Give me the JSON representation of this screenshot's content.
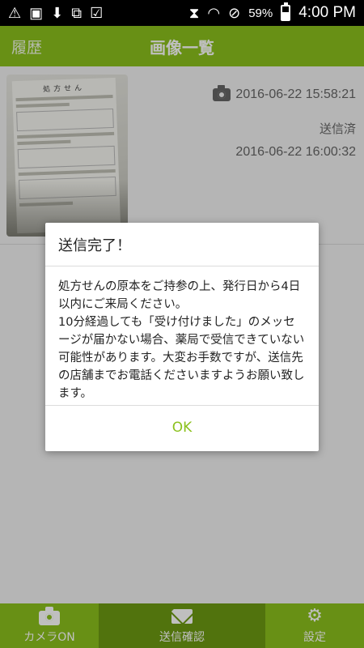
{
  "status_bar": {
    "left_icons": [
      "warning-icon",
      "image-icon",
      "download-icon",
      "screen-share-icon",
      "clipboard-check-icon"
    ],
    "right_icons": [
      "vibrate-mute-icon",
      "wifi-icon",
      "do-not-disturb-icon",
      "battery-icon"
    ],
    "battery": "59%",
    "battery_level": 0.59,
    "time": "4:00 PM"
  },
  "header": {
    "back_label": "履歴",
    "title": "画像一覧"
  },
  "list": {
    "items": [
      {
        "thumb_title": "処方せん",
        "captured_at": "2016-06-22 15:58:21",
        "status": "送信済",
        "sent_at": "2016-06-22 16:00:32"
      }
    ]
  },
  "dialog": {
    "title": "送信完了！",
    "message": "処方せんの原本をご持参の上、発行日から4日以内にご来局ください。\n10分経過しても「受け付けました」のメッセージが届かない場合、薬局で受信できていない可能性があります。大変お手数ですが、送信先の店舗までお電話くださいますようお願い致します。",
    "ok_label": "OK"
  },
  "bottom_nav": {
    "items": [
      {
        "label": "カメラON",
        "icon": "camera-icon"
      },
      {
        "label": "送信確認",
        "icon": "mail-icon",
        "active": true
      },
      {
        "label": "設定",
        "icon": "gear-icon"
      }
    ]
  },
  "colors": {
    "accent": "#8bc11d",
    "accent_dark": "#6c9a12"
  }
}
